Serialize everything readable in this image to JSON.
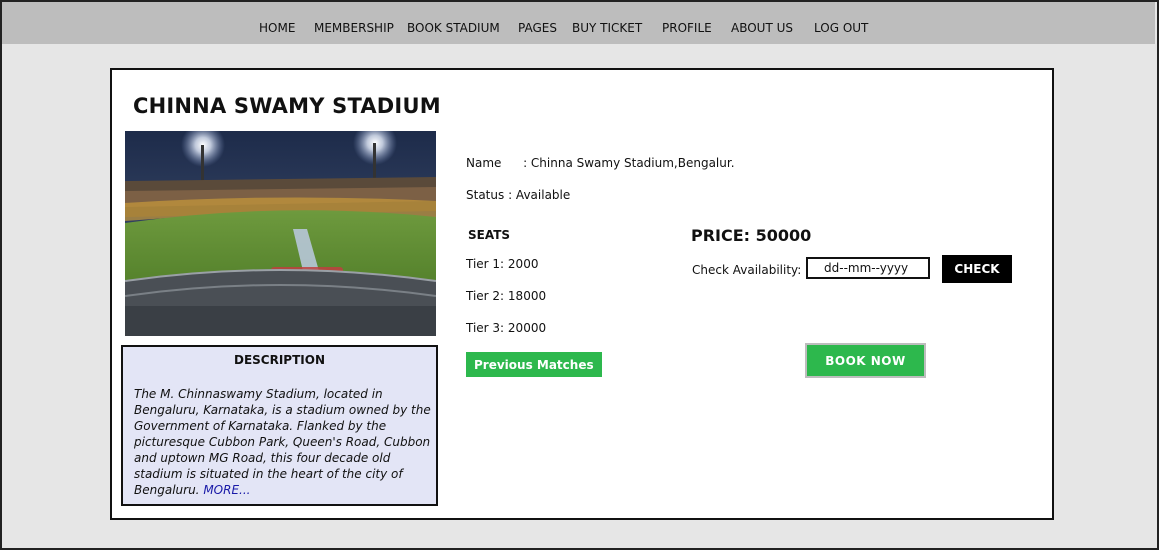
{
  "nav": {
    "home": "HOME",
    "membership": "MEMBERSHIP",
    "book_stadium": "BOOK STADIUM",
    "pages": "PAGES",
    "buy_ticket": "BUY TICKET",
    "profile": "PROFILE",
    "about_us": "ABOUT US",
    "log_out": "LOG OUT"
  },
  "stadium": {
    "title": "CHINNA SWAMY STADIUM",
    "name_label": "Name",
    "name_value": ": Chinna Swamy Stadium,Bengalur.",
    "status_label": "Status",
    "status_value": ": Available"
  },
  "description": {
    "heading": "DESCRIPTION",
    "text": "The M. Chinnaswamy Stadium, located in Bengaluru, Karnataka, is a stadium owned by the Government of Karnataka. Flanked by the picturesque Cubbon Park, Queen's Road, Cubbon and uptown MG Road, this four decade old stadium is situated in the heart of the city of Bengaluru. ",
    "more_link": "MORE..."
  },
  "seats": {
    "heading": "SEATS",
    "tier1": "Tier 1: 2000",
    "tier2": "Tier 2: 18000",
    "tier3": "Tier 3: 20000"
  },
  "booking": {
    "price": "PRICE: 50000",
    "check_label": "Check  Availability:",
    "date_placeholder": "dd--mm--yyyy",
    "check_button": "CHECK",
    "book_button": "BOOK NOW",
    "prev_matches_button": "Previous Matches"
  },
  "colors": {
    "nav_bg": "#bdbdbd",
    "page_bg": "#e6e6e6",
    "button_green": "#2db84d",
    "desc_bg": "#e3e5f6"
  }
}
